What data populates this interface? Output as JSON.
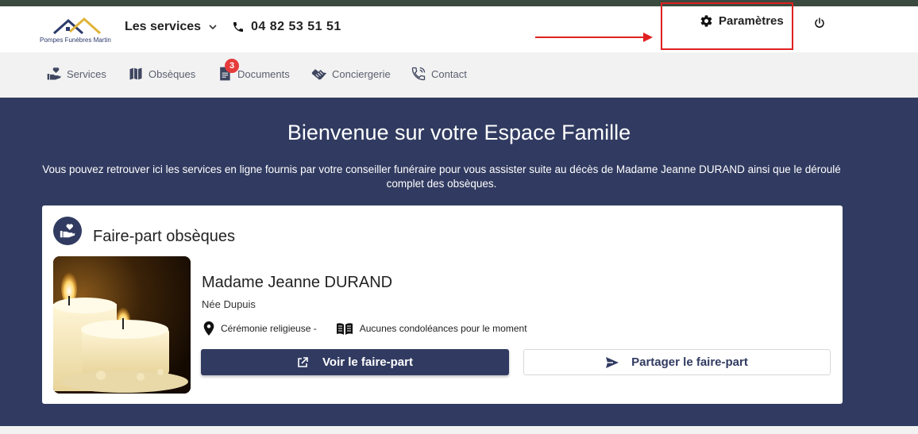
{
  "colors": {
    "brand_navy": "#313b61",
    "top_strip": "#3a4a3e",
    "badge_red": "#e63b3b",
    "annotation_red": "#e02020"
  },
  "header": {
    "logo_text": "Pompes Funèbres Martin",
    "services_label": "Les services",
    "phone_number": "04 82 53 51 51",
    "settings_label": "Paramètres"
  },
  "nav": {
    "items": [
      {
        "label": "Services",
        "icon": "hand-heart-icon"
      },
      {
        "label": "Obsèques",
        "icon": "map-icon"
      },
      {
        "label": "Documents",
        "icon": "document-icon",
        "badge": "3"
      },
      {
        "label": "Conciergerie",
        "icon": "handshake-icon"
      },
      {
        "label": "Contact",
        "icon": "phone-call-icon"
      }
    ]
  },
  "hero": {
    "title": "Bienvenue sur votre Espace Famille",
    "intro": "Vous pouvez retrouver ici les services en ligne fournis par votre conseiller funéraire pour vous assister suite au décès de Madame Jeanne DURAND ainsi que le déroulé complet des obsèques."
  },
  "card": {
    "title": "Faire-part obsèques",
    "name": "Madame Jeanne DURAND",
    "maiden_name": "Née Dupuis",
    "ceremony": "Cérémonie religieuse -",
    "condolences": "Aucunes condoléances pour le moment",
    "view_button": "Voir le faire-part",
    "share_button": "Partager le faire-part"
  }
}
